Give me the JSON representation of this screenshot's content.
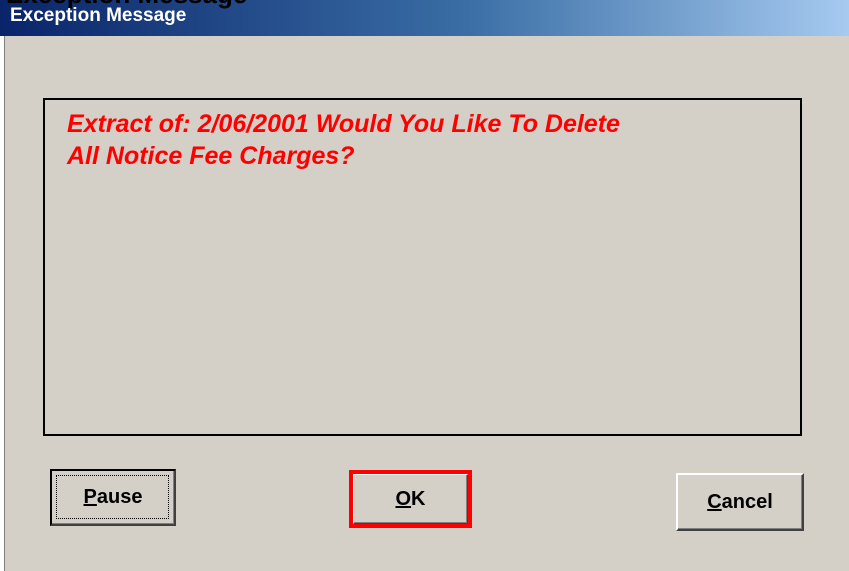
{
  "cropped_heading": "Exception Message",
  "window": {
    "title": "Exception Message"
  },
  "message": {
    "line1": "Extract of: 2/06/2001 Would You Like To Delete",
    "line2": "All Notice Fee Charges?",
    "color": "#ff0000"
  },
  "buttons": {
    "pause": "Pause",
    "ok": "OK",
    "cancel": "Cancel"
  },
  "colors": {
    "dialog_background": "#d4d0c8",
    "titlebar_start": "#0a246a",
    "titlebar_end": "#a6caf0",
    "highlight": "#ff0000"
  }
}
